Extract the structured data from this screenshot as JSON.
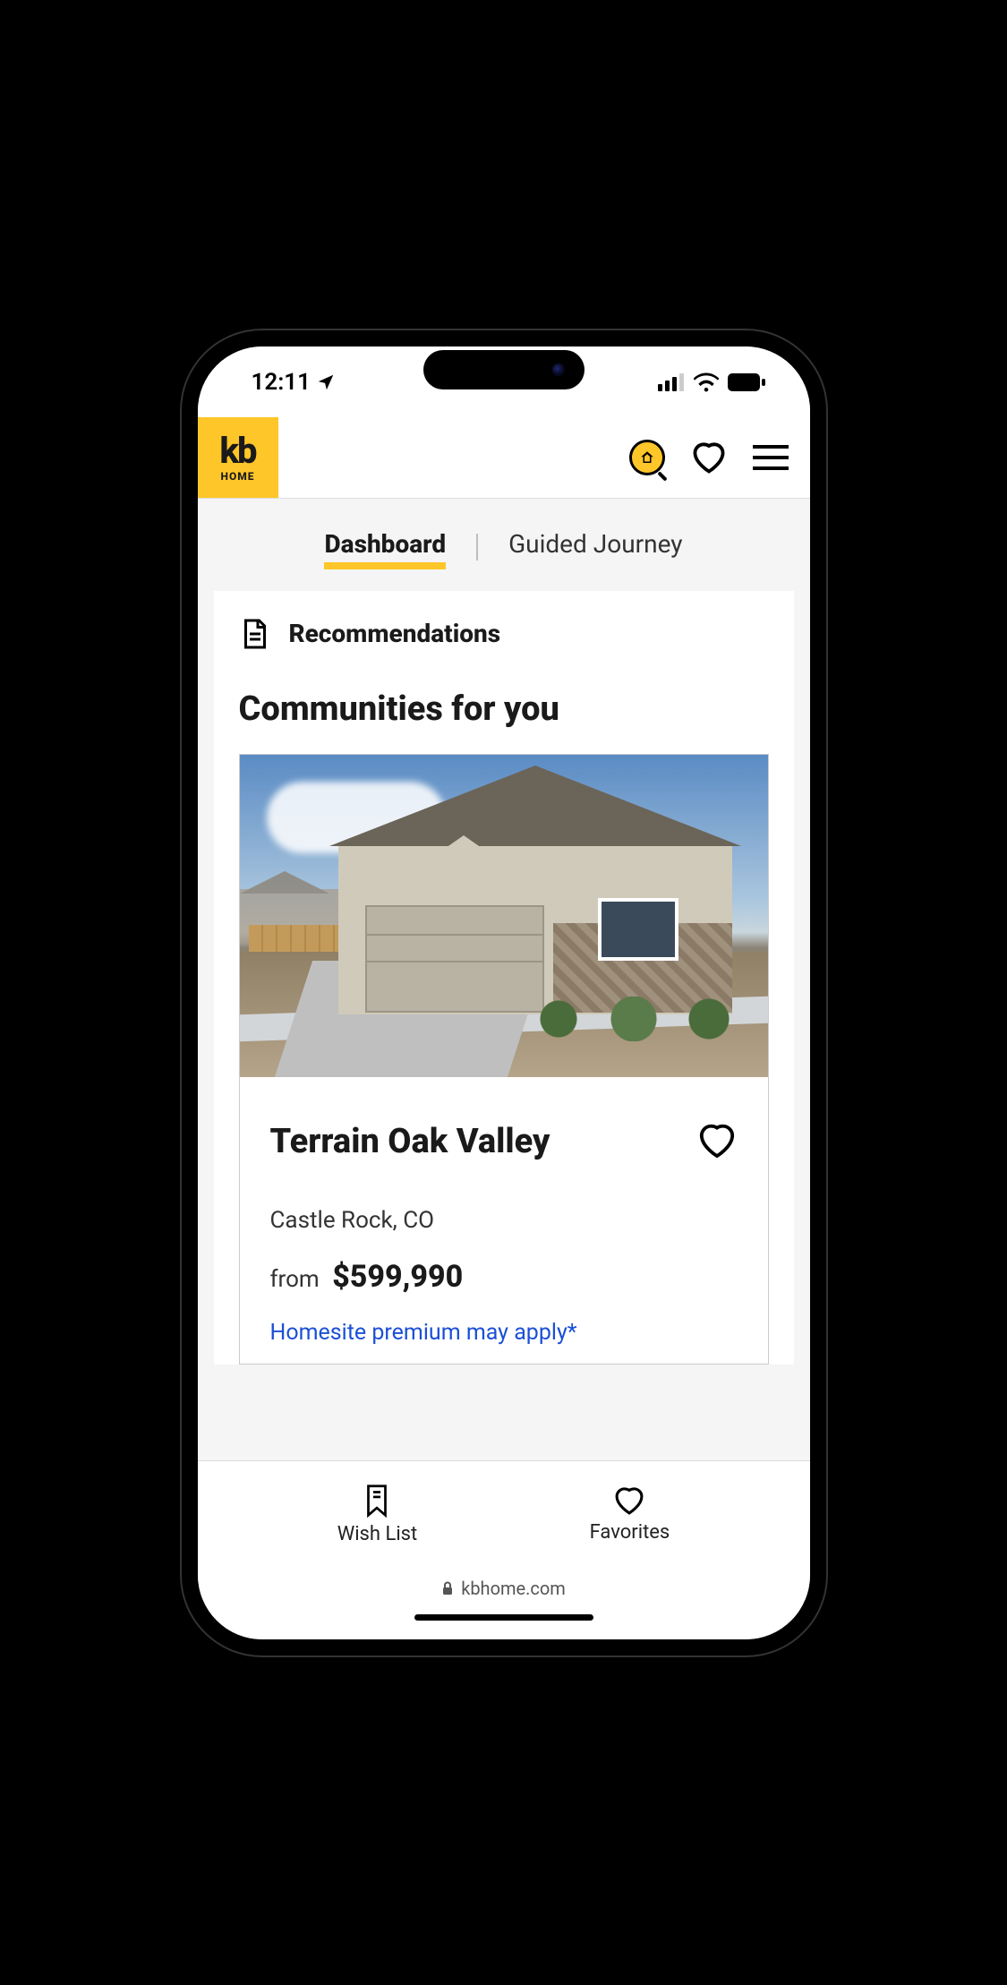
{
  "status": {
    "time": "12:11",
    "location_icon": "location-arrow"
  },
  "logo": {
    "line1": "kb",
    "line2": "HOME"
  },
  "tabs": {
    "dashboard": "Dashboard",
    "guided": "Guided Journey"
  },
  "recommendations": {
    "label": "Recommendations"
  },
  "section": {
    "title": "Communities for you"
  },
  "community": {
    "name": "Terrain Oak Valley",
    "location": "Castle Rock, CO",
    "price_prefix": "from",
    "price": "$599,990",
    "note": "Homesite premium may apply*"
  },
  "bottom_nav": {
    "wishlist": "Wish List",
    "favorites": "Favorites"
  },
  "browser": {
    "url": "kbhome.com"
  }
}
